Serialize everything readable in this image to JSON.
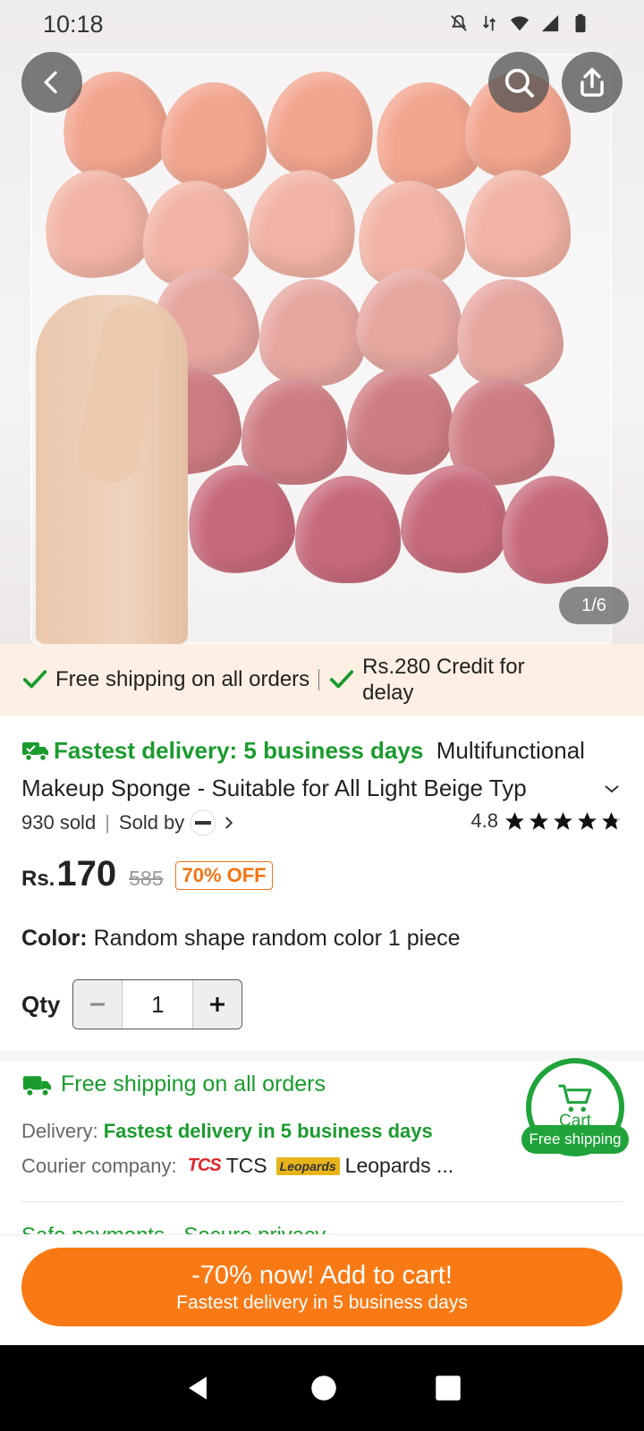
{
  "status_bar": {
    "time": "10:18",
    "icons": [
      "mute-icon",
      "data-icon",
      "wifi-icon",
      "signal-icon",
      "battery-icon"
    ]
  },
  "gallery": {
    "page_indicator": "1/6",
    "current": 1,
    "total": 6
  },
  "top_buttons": {
    "back": "back-icon",
    "search": "search-icon",
    "share": "share-icon"
  },
  "banner": {
    "item1": "Free shipping on all orders",
    "item2_line1": "Rs.280 Credit for",
    "item2_line2": "delay"
  },
  "product": {
    "delivery_badge": "Fastest delivery: 5 business days",
    "title": "Multifunctional Makeup Sponge - Suitable for All Light Beige Typ",
    "sold": "930 sold",
    "sold_by": "Sold by",
    "rating": "4.8",
    "rating_value": 4.8,
    "currency": "Rs.",
    "price": "170",
    "old_price": "585",
    "discount": "70% OFF",
    "color_label": "Color:",
    "color_value": "Random shape random color 1 piece",
    "qty_label": "Qty",
    "qty_value": "1"
  },
  "shipping": {
    "title": "Free shipping on all orders",
    "delivery_label": "Delivery:",
    "delivery_value": "Fastest delivery in 5 business days",
    "courier_label": "Courier company:",
    "tcs_logo": "TCS",
    "courier1": "TCS",
    "leopards_logo": "Leopards",
    "courier2": "Leopards ...",
    "next_row": "Safe payments · Secure privacy"
  },
  "cart_float": {
    "label": "Cart",
    "tag": "Free shipping"
  },
  "cta": {
    "line1": "-70% now! Add to cart!",
    "line2": "Fastest delivery in 5 business days"
  },
  "colors": {
    "accent_orange": "#f97a14",
    "green": "#1a9b2e",
    "banner_bg": "#fdefe3"
  }
}
